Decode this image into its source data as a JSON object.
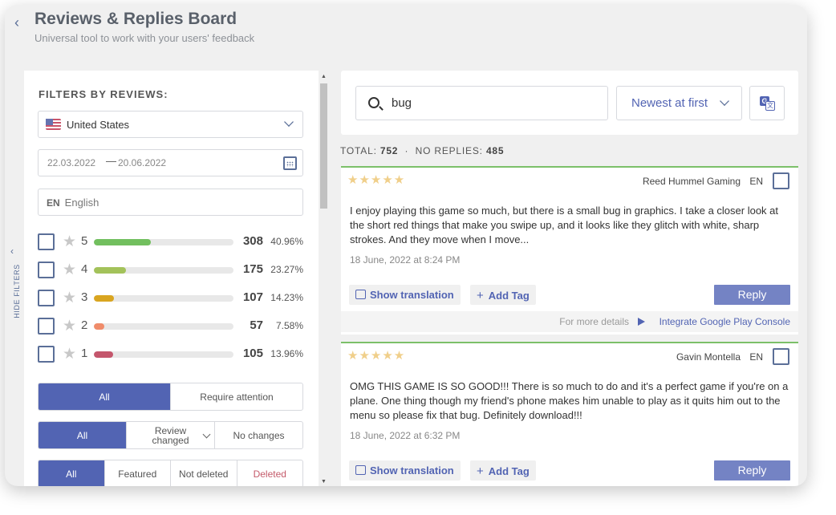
{
  "header": {
    "title": "Reviews & Replies Board",
    "subtitle": "Universal tool to work with your users' feedback"
  },
  "sidebar_toggle": {
    "label": "HIDE FILTERS"
  },
  "filters": {
    "title": "FILTERS BY REVIEWS:",
    "country": "United States",
    "date_from": "22.03.2022",
    "date_sep": "—",
    "date_to": "20.06.2022",
    "language_code": "EN",
    "language": "English",
    "ratings": [
      {
        "stars": "5",
        "count": "308",
        "percent": "40.96%",
        "fraction": 0.4096,
        "color": "#72bf5e"
      },
      {
        "stars": "4",
        "count": "175",
        "percent": "23.27%",
        "fraction": 0.2327,
        "color": "#a3c25a"
      },
      {
        "stars": "3",
        "count": "107",
        "percent": "14.23%",
        "fraction": 0.1423,
        "color": "#d9a520"
      },
      {
        "stars": "2",
        "count": "57",
        "percent": "7.58%",
        "fraction": 0.0758,
        "color": "#f08c6a"
      },
      {
        "stars": "1",
        "count": "105",
        "percent": "13.96%",
        "fraction": 0.1396,
        "color": "#c4566c"
      }
    ],
    "attention": {
      "all": "All",
      "require": "Require attention"
    },
    "changes": {
      "all": "All",
      "review_changed": "Review changed",
      "no_changes": "No changes"
    },
    "deletion": {
      "all": "All",
      "featured": "Featured",
      "not_deleted": "Not deleted",
      "deleted": "Deleted"
    }
  },
  "search": {
    "value": "bug",
    "sort": "Newest at first"
  },
  "totals": {
    "total_label": "TOTAL:",
    "total": "752",
    "sep": "·",
    "no_replies_label": "NO REPLIES:",
    "no_replies": "485"
  },
  "reviews": [
    {
      "stars": "★★★★★",
      "author": "Reed Hummel Gaming",
      "lang": "EN",
      "text": "I enjoy playing this game so much, but there is a small bug in graphics. I take a closer look at the short red things that make you swipe up, and it looks like they glitch with white, sharp strokes. And they move when I move...",
      "date": "18 June, 2022 at 8:24 PM",
      "show_translation": "Show translation",
      "add_tag": "Add Tag",
      "reply": "Reply",
      "more": "For more details",
      "integrate": "Integrate Google Play Console"
    },
    {
      "stars": "★★★★★",
      "author": "Gavin Montella",
      "lang": "EN",
      "text": "OMG THIS GAME IS SO GOOD!!! There is so much to do and it's a perfect game if you're on a plane. One thing though my friend's phone makes him unable to play as it quits him out to the menu so please fix that bug. Definitely download!!!",
      "date": "18 June, 2022 at 6:32 PM",
      "show_translation": "Show translation",
      "add_tag": "Add Tag",
      "reply": "Reply"
    }
  ],
  "colors": {
    "accent": "#5264b3",
    "reply": "#7483c4",
    "green_border": "#7cc069",
    "star": "#f0cf8a"
  },
  "icons": {
    "back": "chevron-left-icon",
    "search": "search-icon",
    "translate": "translate-icon",
    "calendar": "calendar-icon",
    "flag": "us-flag-icon",
    "google_play": "google-play-icon"
  }
}
